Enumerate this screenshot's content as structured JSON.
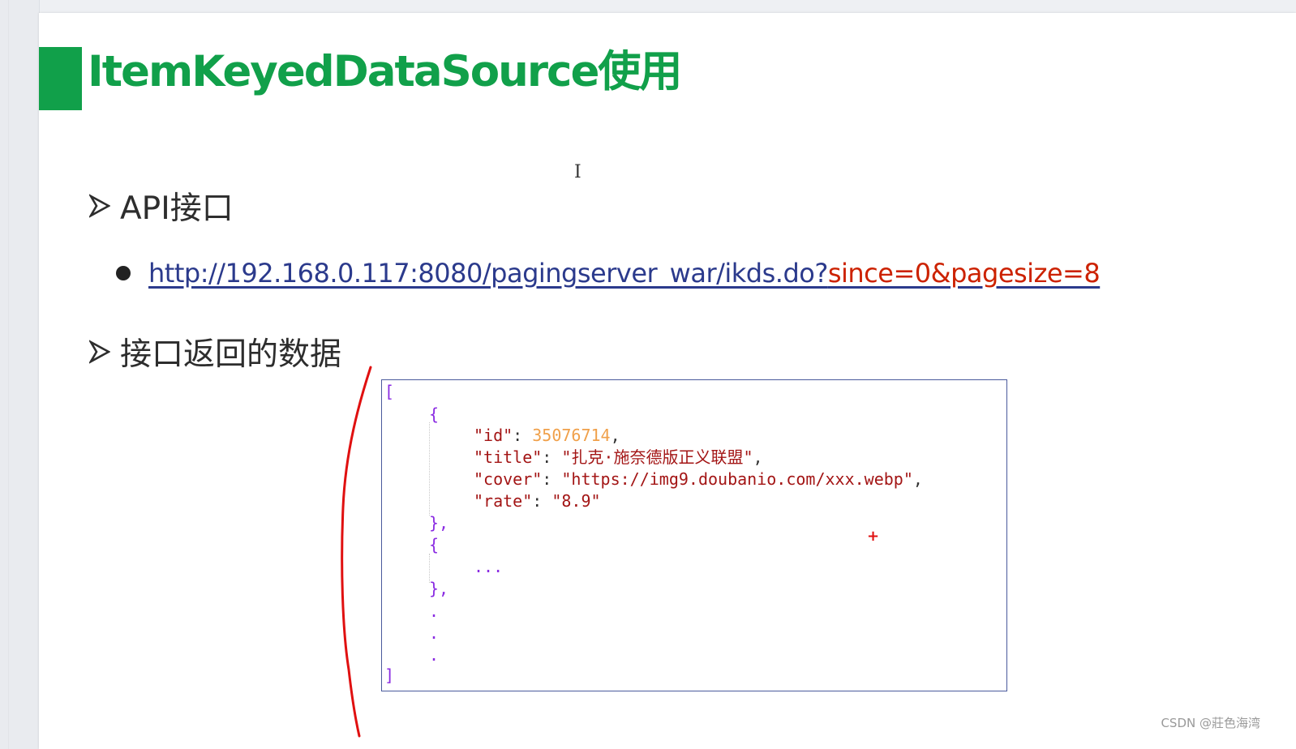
{
  "colors": {
    "title_green": "#11a04a",
    "text_dark": "#2d2d2d",
    "link_blue": "#2b3a8c",
    "link_red": "#cc2200",
    "json_key": "#a31515",
    "json_number": "#f0a04a",
    "json_string": "#a31515",
    "json_bracket": "#8a2be2",
    "json_punct": "#333333",
    "annotation_red": "#e01010",
    "plus_red": "#e01010"
  },
  "slide": {
    "title": "ItemKeyedDataSource使用",
    "sections": [
      {
        "label": "API接口",
        "icon": "arrow-bullet-icon"
      },
      {
        "label": "接口返回的数据",
        "icon": "arrow-bullet-icon"
      }
    ],
    "api_url": {
      "base": "http://192.168.0.117:8080/pagingserver_war/ikds.do?",
      "params": "since=0&pagesize=8"
    }
  },
  "code": {
    "open_bracket": "[",
    "close_bracket": "]",
    "obj_open": "{",
    "obj_close": "},",
    "fields": [
      {
        "key": "\"id\"",
        "value": "35076714",
        "value_type": "number"
      },
      {
        "key": "\"title\"",
        "value": "\"扎克·施奈德版正义联盟\"",
        "value_type": "string"
      },
      {
        "key": "\"cover\"",
        "value": "\"https://img9.doubanio.com/xxx.webp\"",
        "value_type": "string"
      },
      {
        "key": "\"rate\"",
        "value": "\"8.9\"",
        "value_type": "string",
        "last": true
      }
    ],
    "ellipsis": "...",
    "dot": "."
  },
  "overlay": {
    "cursor": "I",
    "plus": "+"
  },
  "watermark": "CSDN @莊色海湾"
}
